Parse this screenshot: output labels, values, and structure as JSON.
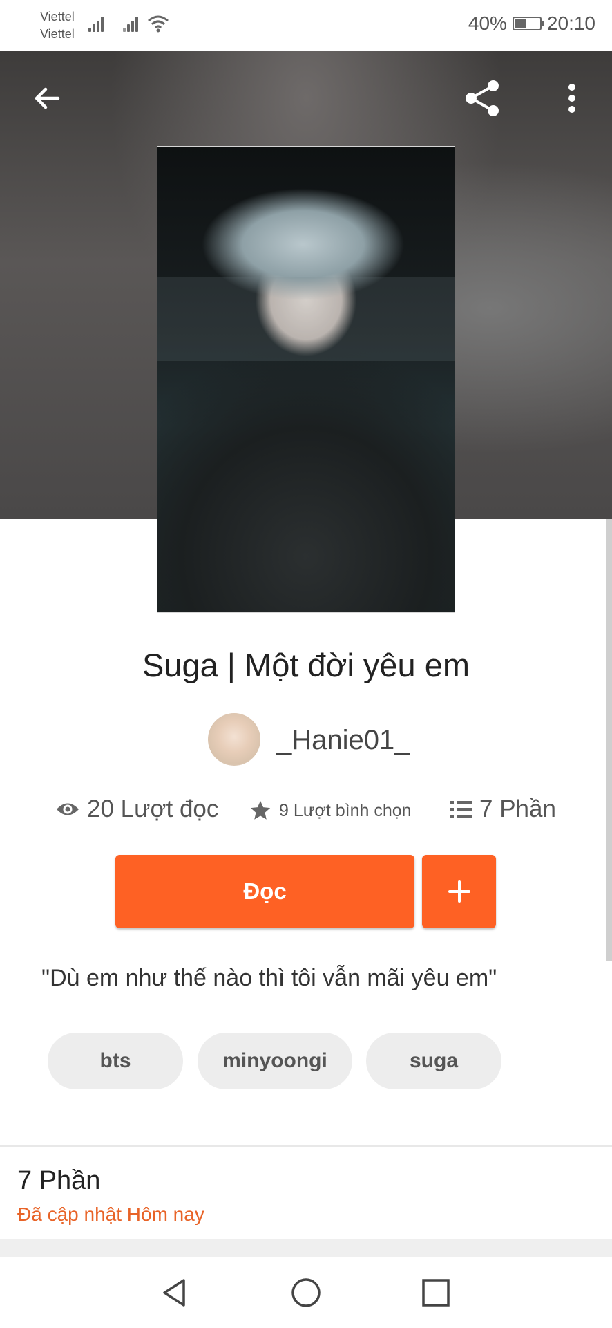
{
  "status_bar": {
    "carrier_1": "Viettel",
    "carrier_2": "Viettel",
    "battery": "40%",
    "time": "20:10"
  },
  "header": {
    "back_icon": "arrow-left-icon",
    "share_icon": "share-icon",
    "more_icon": "more-vertical-icon"
  },
  "story": {
    "title": "Suga | Một đời yêu em",
    "author": "_Hanie01_",
    "reads": "20 Lượt đọc",
    "votes": "9 Lượt bình chọn",
    "parts": "7 Phần",
    "read_button": "Đọc",
    "add_button_icon": "plus-icon",
    "description": "\"Dù em như thế nào thì tôi vẫn mãi yêu em\"",
    "tags": [
      "bts",
      "minyoongi",
      "suga"
    ]
  },
  "parts_section": {
    "title": "7 Phần",
    "updated": "Đã cập nhật Hôm nay"
  },
  "colors": {
    "accent": "#fe6124",
    "updated_text": "#e86327"
  }
}
